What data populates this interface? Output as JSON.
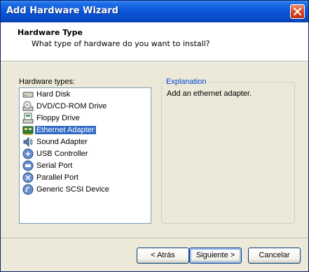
{
  "window": {
    "title": "Add Hardware Wizard"
  },
  "header": {
    "title": "Hardware Type",
    "subtitle": "What type of hardware do you want to install?"
  },
  "hardware_list": {
    "label": "Hardware types:",
    "selected_index": 3,
    "items": [
      {
        "label": "Hard Disk",
        "icon": "hard-disk-icon"
      },
      {
        "label": "DVD/CD-ROM Drive",
        "icon": "dvd-drive-icon"
      },
      {
        "label": "Floppy Drive",
        "icon": "floppy-drive-icon"
      },
      {
        "label": "Ethernet Adapter",
        "icon": "network-adapter-icon"
      },
      {
        "label": "Sound Adapter",
        "icon": "speaker-icon"
      },
      {
        "label": "USB Controller",
        "icon": "usb-icon"
      },
      {
        "label": "Serial Port",
        "icon": "serial-port-icon"
      },
      {
        "label": "Parallel Port",
        "icon": "parallel-port-icon"
      },
      {
        "label": "Generic SCSI Device",
        "icon": "scsi-icon"
      }
    ]
  },
  "explanation": {
    "title": "Explanation",
    "text": "Add an ethernet adapter."
  },
  "buttons": {
    "back": "< Atrás",
    "next": "Siguiente >",
    "cancel": "Cancelar"
  },
  "colors": {
    "titlebar": "#0a55d8",
    "selection": "#316ac5",
    "group_title": "#0046d5"
  }
}
